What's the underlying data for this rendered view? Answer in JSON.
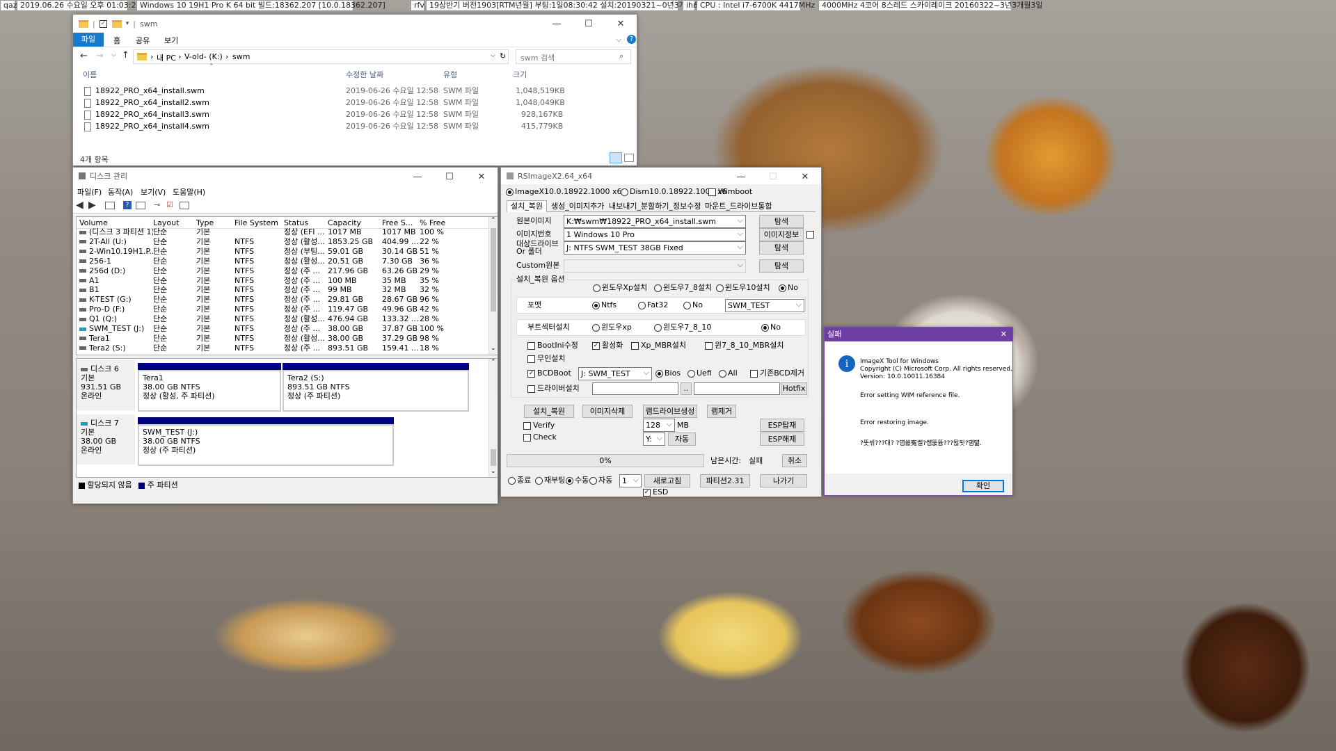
{
  "taskbar": {
    "t1": "qaz",
    "t2": "2019.06.26 수요일 오후 01:03:28",
    "t3": "Windows 10 19H1 Pro K 64 bit 빌드:18362.207 [10.0.18362.207]",
    "t4": "rfv",
    "t5": "19상반기 버전1903[RTM년월] 부팅:1일08:30:42 설치:20190321~0년3개월5일",
    "t6": "ihn",
    "t7": "CPU : Intel i7-6700K 4417MHz",
    "t8": "4000MHz 4코어 8스레드 스카이레이크 20160322~3년3개월3일"
  },
  "explorer": {
    "title": "swm",
    "tabs": {
      "file": "파일",
      "home": "홈",
      "share": "공유",
      "view": "보기"
    },
    "path": {
      "pc": "내 PC",
      "drive": "V-old- (K:)",
      "folder": "swm"
    },
    "search_placeholder": "swm 검색",
    "cols": {
      "name": "이름",
      "date": "수정한 날짜",
      "type": "유형",
      "size": "크기"
    },
    "files": [
      {
        "name": "18922_PRO_x64_install.swm",
        "date": "2019-06-26 수요일 12:58",
        "type": "SWM 파일",
        "size": "1,048,519KB"
      },
      {
        "name": "18922_PRO_x64_install2.swm",
        "date": "2019-06-26 수요일 12:58",
        "type": "SWM 파일",
        "size": "1,048,049KB"
      },
      {
        "name": "18922_PRO_x64_install3.swm",
        "date": "2019-06-26 수요일 12:58",
        "type": "SWM 파일",
        "size": "928,167KB"
      },
      {
        "name": "18922_PRO_x64_install4.swm",
        "date": "2019-06-26 수요일 12:58",
        "type": "SWM 파일",
        "size": "415,779KB"
      }
    ],
    "status": "4개 항목"
  },
  "diskmgmt": {
    "title": "디스크 관리",
    "menu": {
      "file": "파일(F)",
      "action": "동작(A)",
      "view": "보기(V)",
      "help": "도움말(H)"
    },
    "cols": {
      "volume": "Volume",
      "layout": "Layout",
      "type": "Type",
      "fs": "File System",
      "status": "Status",
      "capacity": "Capacity",
      "free": "Free S...",
      "pct": "% Free"
    },
    "rows": [
      {
        "vol": "(디스크 3 파티션 1)",
        "layout": "단순",
        "type": "기본",
        "fs": "",
        "status": "정상 (EFI ...",
        "cap": "1017 MB",
        "free": "1017 MB",
        "pct": "100 %"
      },
      {
        "vol": "2T-All (U:)",
        "layout": "단순",
        "type": "기본",
        "fs": "NTFS",
        "status": "정상 (활성...",
        "cap": "1853.25 GB",
        "free": "404.99 ...",
        "pct": "22 %"
      },
      {
        "vol": "2-Win10.19H1.P...",
        "layout": "단순",
        "type": "기본",
        "fs": "NTFS",
        "status": "정상 (부팅...",
        "cap": "59.01 GB",
        "free": "30.14 GB",
        "pct": "51 %"
      },
      {
        "vol": "256-1",
        "layout": "단순",
        "type": "기본",
        "fs": "NTFS",
        "status": "정상 (활성...",
        "cap": "20.51 GB",
        "free": "7.30 GB",
        "pct": "36 %"
      },
      {
        "vol": "256d (D:)",
        "layout": "단순",
        "type": "기본",
        "fs": "NTFS",
        "status": "정상 (주 ...",
        "cap": "217.96 GB",
        "free": "63.26 GB",
        "pct": "29 %"
      },
      {
        "vol": "A1",
        "layout": "단순",
        "type": "기본",
        "fs": "NTFS",
        "status": "정상 (주 ...",
        "cap": "100 MB",
        "free": "35 MB",
        "pct": "35 %"
      },
      {
        "vol": "B1",
        "layout": "단순",
        "type": "기본",
        "fs": "NTFS",
        "status": "정상 (주 ...",
        "cap": "99 MB",
        "free": "32 MB",
        "pct": "32 %"
      },
      {
        "vol": "K-TEST (G:)",
        "layout": "단순",
        "type": "기본",
        "fs": "NTFS",
        "status": "정상 (주 ...",
        "cap": "29.81 GB",
        "free": "28.67 GB",
        "pct": "96 %"
      },
      {
        "vol": "Pro-D (F:)",
        "layout": "단순",
        "type": "기본",
        "fs": "NTFS",
        "status": "정상 (주 ...",
        "cap": "119.47 GB",
        "free": "49.96 GB",
        "pct": "42 %"
      },
      {
        "vol": "Q1 (Q:)",
        "layout": "단순",
        "type": "기본",
        "fs": "NTFS",
        "status": "정상 (활성...",
        "cap": "476.94 GB",
        "free": "133.32 ...",
        "pct": "28 %"
      },
      {
        "vol": "SWM_TEST (J:)",
        "layout": "단순",
        "type": "기본",
        "fs": "NTFS",
        "status": "정상 (주 ...",
        "cap": "38.00 GB",
        "free": "37.87 GB",
        "pct": "100 %"
      },
      {
        "vol": "Tera1",
        "layout": "단순",
        "type": "기본",
        "fs": "NTFS",
        "status": "정상 (활성...",
        "cap": "38.00 GB",
        "free": "37.29 GB",
        "pct": "98 %"
      },
      {
        "vol": "Tera2 (S:)",
        "layout": "단순",
        "type": "기본",
        "fs": "NTFS",
        "status": "정상 (주 ...",
        "cap": "893.51 GB",
        "free": "159.41 ...",
        "pct": "18 %"
      }
    ],
    "disk6": {
      "name": "디스크 6",
      "kind": "기본",
      "size": "931.51 GB",
      "state": "온라인",
      "p1": {
        "name": "Tera1",
        "info": "38.00 GB NTFS",
        "status": "정상 (활성, 주 파티션)"
      },
      "p2": {
        "name": "Tera2  (S:)",
        "info": "893.51 GB NTFS",
        "status": "정상 (주 파티션)"
      }
    },
    "disk7": {
      "name": "디스크 7",
      "kind": "기본",
      "size": "38.00 GB",
      "state": "온라인",
      "p1": {
        "name": "SWM_TEST  (J:)",
        "info": "38.00 GB NTFS",
        "status": "정상 (주 파티션)"
      }
    },
    "legend": {
      "unalloc": "할당되지 않음",
      "primary": "주 파티션"
    }
  },
  "rsimage": {
    "title": "RSImageX2.64_x64",
    "mode_imagex": "ImageX10.0.18922.1000 x64",
    "mode_dism": "Dism10.0.18922.1000 x6",
    "wimboot": "Wimboot",
    "tabs": [
      "설치_복원",
      "생성_이미지추가",
      "내보내기_분할하기_정보수정",
      "마운트_드라이브통합"
    ],
    "src_label": "원본이미지",
    "src_value": "K:₩swm₩18922_PRO_x64_install.swm",
    "browse": "탐색",
    "idx_label": "이미지번호",
    "idx_value": "1  Windows 10 Pro",
    "info_btn": "이미지정보",
    "target_label": "대상드라이브",
    "target_label2": "Or 폴더",
    "target_value": "J:  NTFS  SWM_TEST       38GB  Fixed",
    "custom_label": "Custom원본",
    "options_title": "설치_복원 옵션",
    "os_opts": [
      "윈도우Xp설치",
      "윈도우7_8설치",
      "윈도우10설치",
      "No"
    ],
    "format_label": "포맷",
    "fmt_opts": [
      "Ntfs",
      "Fat32",
      "No"
    ],
    "volume_label": "SWM_TEST",
    "bootsector_label": "부트섹터설치",
    "bs_opts": [
      "윈도우xp",
      "윈도우7_8_10",
      "No"
    ],
    "bootini": "BootIni수정",
    "activate": "활성화",
    "xp_mbr": "Xp_MBR설치",
    "w7_mbr": "윈7_8_10_MBR설치",
    "unattend": "무인설치",
    "bcdboot": "BCDBoot",
    "bcd_drive": "J: SWM_TEST",
    "bios": "Bios",
    "uefi": "Uefi",
    "all": "All",
    "bcd_remove": "기존BCD제거",
    "driver": "드라이버설치",
    "dots": "..",
    "hotfix": "Hotfix",
    "btn_install": "설치_복원",
    "btn_delete": "이미지삭제",
    "btn_ramdrive": "램드라이브생성",
    "btn_ramremove": "램제거",
    "verify": "Verify",
    "check": "Check",
    "ram_size": "128",
    "mb": "MB",
    "drive_letter": "Y:",
    "auto": "자동",
    "esp_mount": "ESP탑재",
    "esp_unmount": "ESP해제",
    "progress": "0%",
    "remaining_label": "남은시간:",
    "remaining_value": "실패",
    "cancel": "취소",
    "end_opts": [
      "종료",
      "재부팅",
      "수동",
      "자동"
    ],
    "count": "1",
    "refresh": "새로고침",
    "partition": "파티션2.31",
    "exit": "나가기",
    "esd": "ESD"
  },
  "dialog": {
    "title": "실패",
    "line1": "ImageX Tool for Windows",
    "line2": "Copyright (C) Microsoft Corp. All rights reserved.",
    "line3": "Version: 10.0.10011.16384",
    "err1": "Error setting WIM reference file.",
    "err2": "Error restoring image.",
    "err3": "?뚯씪???대? ?덉쓣寃쎌?썝뚮뜝???뒪됫?덈떎.",
    "ok": "확인"
  }
}
